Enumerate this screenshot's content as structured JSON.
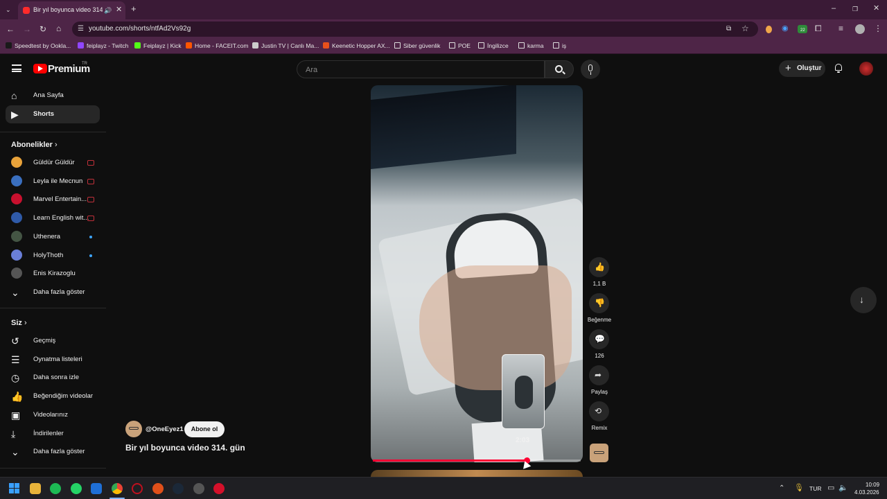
{
  "browser": {
    "tab_title": "Bir yıl boyunca video 314. g",
    "url": "youtube.com/shorts/ntfAd2Vs92g",
    "bookmarks": [
      {
        "label": "Speedtest by Ookla...",
        "color": "#1a1a1a"
      },
      {
        "label": "feiplayz - Twitch",
        "color": "#9146ff"
      },
      {
        "label": "Feiplayz | Kick",
        "color": "#53fc18"
      },
      {
        "label": "Home - FACEIT.com",
        "color": "#ff5500"
      },
      {
        "label": "Justin TV | Canlı Ma...",
        "color": "#cccccc"
      },
      {
        "label": "Keenetic Hopper AX...",
        "color": "#e8501c"
      },
      {
        "label": "Siber güvenlik",
        "color": "folder"
      },
      {
        "label": "POE",
        "color": "folder"
      },
      {
        "label": "İngilizce",
        "color": "folder"
      },
      {
        "label": "karma",
        "color": "folder"
      },
      {
        "label": "iş",
        "color": "folder"
      }
    ],
    "extension_badge": "22"
  },
  "youtube": {
    "logo": "Premium",
    "logo_sup": "TR",
    "search_placeholder": "Ara",
    "create_label": "Oluştur",
    "sidebar": {
      "main": [
        {
          "label": "Ana Sayfa",
          "icon": "home-icon"
        },
        {
          "label": "Shorts",
          "icon": "shorts-icon",
          "active": true
        }
      ],
      "subscriptions_title": "Abonelikler",
      "subscriptions": [
        {
          "label": "Güldür Güldür",
          "status": "live",
          "color": "#e8a23a"
        },
        {
          "label": "Leyla ile Mecnun",
          "status": "live",
          "color": "#3a6fbf"
        },
        {
          "label": "Marvel Entertain...",
          "status": "live",
          "color": "#c8102e"
        },
        {
          "label": "Learn English wit...",
          "status": "live",
          "color": "#2f5aa8"
        },
        {
          "label": "Uthenera",
          "status": "new",
          "color": "#445544"
        },
        {
          "label": "HolyThoth",
          "status": "new",
          "color": "#6a7fd8"
        },
        {
          "label": "Enis Kirazoglu",
          "status": "",
          "color": "#555555"
        }
      ],
      "show_more_subs": "Daha fazla göster",
      "you_title": "Siz",
      "you": [
        {
          "label": "Geçmiş",
          "icon": "history-icon"
        },
        {
          "label": "Oynatma listeleri",
          "icon": "playlists-icon"
        },
        {
          "label": "Daha sonra izle",
          "icon": "watch-later-icon"
        },
        {
          "label": "Beğendiğim videolar",
          "icon": "liked-icon"
        },
        {
          "label": "Videolarınız",
          "icon": "your-videos-icon"
        },
        {
          "label": "İndirilenler",
          "icon": "downloads-icon"
        }
      ],
      "show_more_you": "Daha fazla göster"
    },
    "short": {
      "channel": "@OneEyez1",
      "subscribe": "Abone ol",
      "title": "Bir yıl boyunca video 314. gün",
      "progress": 0.74,
      "hover_time": "2:03",
      "actions": {
        "like_count": "1,1 B",
        "dislike_label": "Beğenme",
        "comment_count": "126",
        "share_label": "Paylaş",
        "remix_label": "Remix"
      }
    }
  },
  "taskbar": {
    "lang": "TUR",
    "time": "10:09",
    "date": "4.03.2026"
  }
}
